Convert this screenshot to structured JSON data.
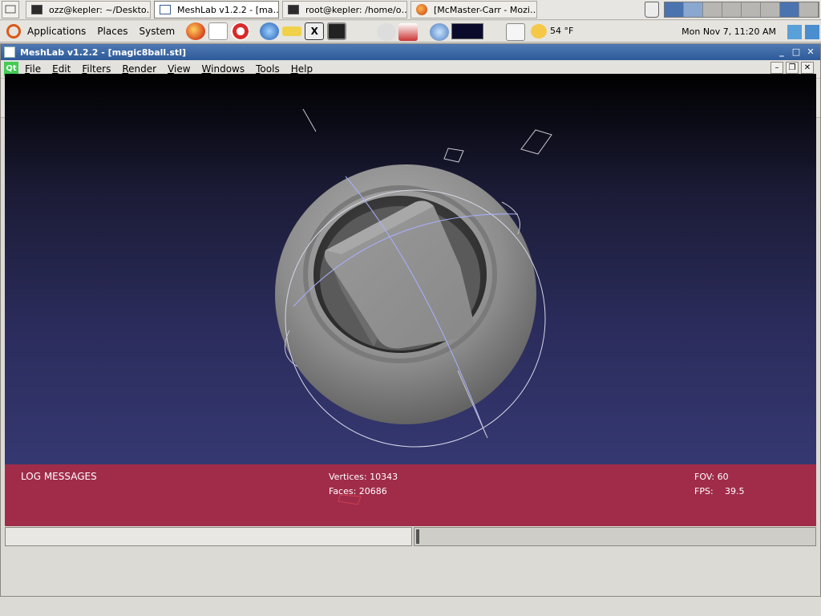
{
  "taskbar": {
    "tasks": [
      {
        "label": "ozz@kepler: ~/Deskto…",
        "icon": "terminal-icon"
      },
      {
        "label": "MeshLab v1.2.2 - [ma…",
        "icon": "meshlab-icon",
        "active": true
      },
      {
        "label": "root@kepler: /home/o…",
        "icon": "terminal-icon"
      },
      {
        "label": "[McMaster-Carr - Mozi…",
        "icon": "firefox-icon"
      }
    ],
    "workspaces": 8,
    "active_workspace": 1
  },
  "panel": {
    "menus": [
      "Applications",
      "Places",
      "System"
    ],
    "weather": "54 °F",
    "clock": "Mon Nov  7, 11:20 AM"
  },
  "window": {
    "title": "MeshLab v1.2.2 - [magic8ball.stl]",
    "menus": [
      {
        "label": "File",
        "mnemonic": "F",
        "rest": "ile"
      },
      {
        "label": "Edit",
        "mnemonic": "E",
        "rest": "dit"
      },
      {
        "label": "Filters",
        "mnemonic": "F",
        "rest": "ilters"
      },
      {
        "label": "Render",
        "mnemonic": "R",
        "rest": "ender"
      },
      {
        "label": "View",
        "mnemonic": "V",
        "rest": "iew"
      },
      {
        "label": "Windows",
        "mnemonic": "W",
        "rest": "indows"
      },
      {
        "label": "Tools",
        "mnemonic": "T",
        "rest": "ools"
      },
      {
        "label": "Help",
        "mnemonic": "H",
        "rest": "elp"
      }
    ],
    "toolbar": [
      "open-folder-icon",
      "reload-icon",
      "save-icon",
      "snapshot-icon",
      "layers-icon",
      "bbox-icon",
      "points-icon",
      "wireframe-icon",
      "hidden-lines-icon",
      "flat-lines-icon",
      "flat-shading-icon",
      "smooth-shading-icon",
      "texture-icon",
      "light-icon",
      "backface-icon",
      "select-icon",
      "measure-icon",
      "pickpoints-icon",
      "paint-icon",
      "select-faces-icon",
      "select-vertices-icon",
      "align-icon",
      "mask-icon",
      "close-icon"
    ]
  },
  "viewport": {
    "log_title": "LOG MESSAGES",
    "vertices_label": "Vertices: 10343",
    "faces_label": "Faces: 20686",
    "fov_label": "FOV: 60",
    "fps_label": "FPS:",
    "fps_value": "39.5"
  }
}
